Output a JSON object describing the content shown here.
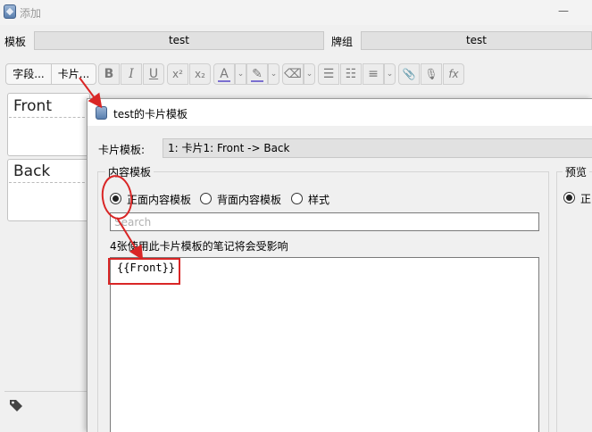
{
  "add_window": {
    "title": "添加",
    "minimize": "—",
    "notetype_label": "模板",
    "notetype_value": "test",
    "deck_label": "牌组",
    "deck_value": "test",
    "fields_button": "字段...",
    "cards_button": "卡片...",
    "toolbar": {
      "bold": "B",
      "italic": "I",
      "underline": "U",
      "superscript": "x²",
      "subscript": "x₂",
      "text_color": "A",
      "highlight": "✎",
      "eraser": "⌫",
      "bullets": "☰",
      "numbers": "☷",
      "align": "≡",
      "attach": "📎",
      "record": "🎙",
      "formula": "fx",
      "caret": "⌄"
    },
    "fields": [
      {
        "name": "Front"
      },
      {
        "name": "Back"
      }
    ]
  },
  "dialog": {
    "title": "test的卡片模板",
    "card_label": "卡片模板:",
    "card_value": "1: 卡片1: Front -> Back",
    "content_group_title": "内容模板",
    "preview_group_title": "预览",
    "radios": [
      {
        "label": "正面内容模板",
        "selected": true
      },
      {
        "label": "背面内容模板",
        "selected": false
      },
      {
        "label": "样式",
        "selected": false
      }
    ],
    "preview_radio_label": "正",
    "search_placeholder": "Search",
    "affect_note": "4张使用此卡片模板的笔记将会受影响",
    "template_text": "{{Front}}"
  },
  "colors": {
    "annotation": "#d92626",
    "text_color_bar": "#7a6fd0",
    "highlight_bar": "#7a6fd0"
  }
}
